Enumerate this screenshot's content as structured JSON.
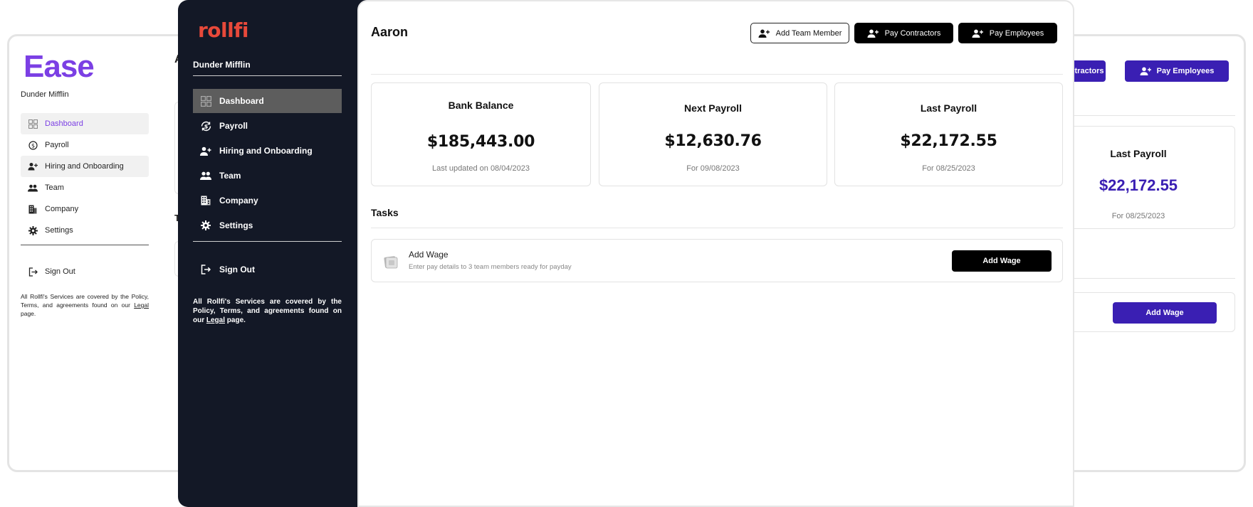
{
  "ease": {
    "logo": "Ease",
    "company": "Dunder Mifflin",
    "nav": [
      {
        "label": "Dashboard",
        "icon": "dashboard-icon"
      },
      {
        "label": "Payroll",
        "icon": "payroll-icon"
      },
      {
        "label": "Hiring and Onboarding",
        "icon": "add-person-icon"
      },
      {
        "label": "Team",
        "icon": "team-icon"
      },
      {
        "label": "Company",
        "icon": "building-icon"
      },
      {
        "label": "Settings",
        "icon": "gear-icon"
      }
    ],
    "signout": "Sign Out",
    "legal_pre": "All Rollfi's Services are covered by the Policy, Terms, and agreements found on our ",
    "legal_link": "Legal",
    "legal_post": " page.",
    "peek_title": "A",
    "peek_tasks": "T",
    "accent": "#7b3fe4"
  },
  "purple": {
    "btn_contractors": "Pay Contractors",
    "btn_employees": "Pay Employees",
    "card_title": "Last Payroll",
    "card_value": "$22,172.55",
    "card_sub": "For 08/25/2023",
    "add_wage": "Add Wage",
    "accent": "#3a1fb3"
  },
  "rollfi": {
    "logo": "rollfi",
    "company": "Dunder Mifflin",
    "nav": [
      {
        "label": "Dashboard",
        "icon": "dashboard-icon"
      },
      {
        "label": "Payroll",
        "icon": "payroll-icon"
      },
      {
        "label": "Hiring and Onboarding",
        "icon": "add-person-icon"
      },
      {
        "label": "Team",
        "icon": "team-icon"
      },
      {
        "label": "Company",
        "icon": "building-icon"
      },
      {
        "label": "Settings",
        "icon": "gear-icon"
      }
    ],
    "signout": "Sign Out",
    "legal_pre": "All Rollfi's Services are covered by the Policy, Terms, and agreements found on our ",
    "legal_link": "Legal",
    "legal_post": " page.",
    "brand": "#e8493a",
    "sidebar_bg": "#131826"
  },
  "main": {
    "title": "Aaron",
    "btn_add_team": "Add Team Member",
    "btn_contractors": "Pay Contractors",
    "btn_employees": "Pay Employees",
    "cards": [
      {
        "title": "Bank Balance",
        "value": "$185,443.00",
        "sub": "Last updated on 08/04/2023"
      },
      {
        "title": "Next Payroll",
        "value": "$12,630.76",
        "sub": "For 09/08/2023"
      },
      {
        "title": "Last Payroll",
        "value": "$22,172.55",
        "sub": "For 08/25/2023"
      }
    ],
    "tasks_title": "Tasks",
    "task": {
      "title": "Add Wage",
      "desc": "Enter pay details to 3 team members ready for payday",
      "button": "Add Wage"
    }
  }
}
